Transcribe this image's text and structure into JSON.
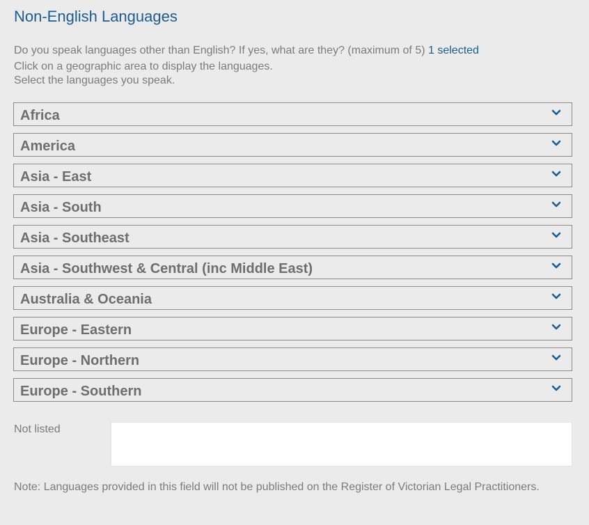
{
  "section": {
    "title": "Non-English Languages"
  },
  "intro": {
    "question": "Do you speak languages other than English? If yes, what are they? (maximum of 5)",
    "selected_count": "1 selected",
    "instruction_1": "Click on a geographic area to display the languages.",
    "instruction_2": "Select the languages you speak."
  },
  "regions": [
    {
      "label": "Africa",
      "icon": "chevron-down-icon"
    },
    {
      "label": "America",
      "icon": "chevron-down-icon"
    },
    {
      "label": "Asia - East",
      "icon": "chevron-down-icon"
    },
    {
      "label": "Asia - South",
      "icon": "chevron-down-icon"
    },
    {
      "label": "Asia - Southeast",
      "icon": "chevron-down-icon"
    },
    {
      "label": "Asia - Southwest & Central (inc Middle East)",
      "icon": "chevron-down-icon"
    },
    {
      "label": "Australia & Oceania",
      "icon": "chevron-down-icon"
    },
    {
      "label": "Europe - Eastern",
      "icon": "chevron-down-icon"
    },
    {
      "label": "Europe - Northern",
      "icon": "chevron-down-icon"
    },
    {
      "label": "Europe - Southern",
      "icon": "chevron-down-icon"
    }
  ],
  "not_listed": {
    "label": "Not listed",
    "value": "",
    "placeholder": ""
  },
  "note": "Note: Languages provided in this field will not be published on the Register of Victorian Legal Practitioners.",
  "colors": {
    "background": "#ebebeb",
    "accent": "#1c5c8f",
    "text": "#7b7b7b",
    "region_text": "#6e6e6e",
    "border": "#8a8a8a"
  }
}
